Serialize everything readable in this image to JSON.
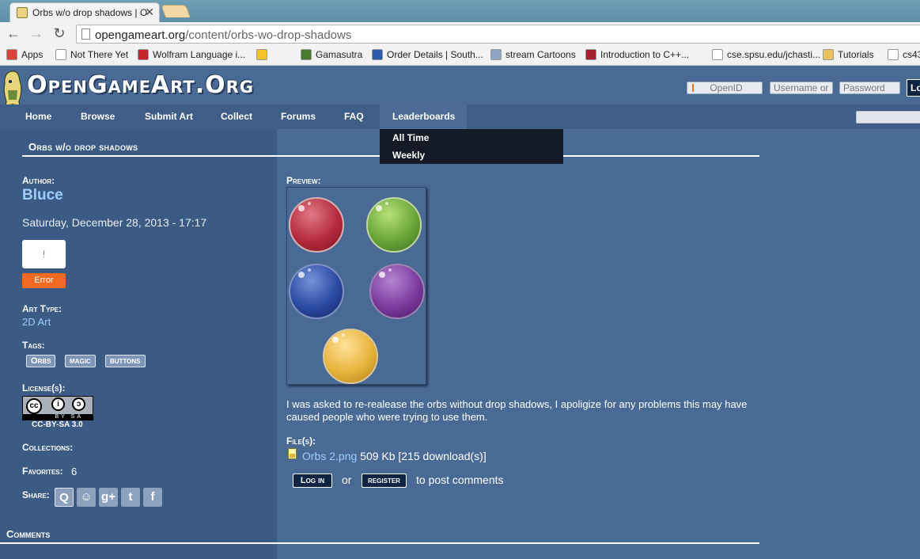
{
  "browser": {
    "tab_title": "Orbs w/o drop shadows | O",
    "tab_close": "✕",
    "url_host": "opengameart.org",
    "url_path": "/content/orbs-wo-drop-shadows",
    "back": "←",
    "forward": "→",
    "reload": "↻",
    "bookmarks": [
      {
        "label": "Apps",
        "color": "#d9453d"
      },
      {
        "label": "Not There Yet",
        "color": "#ffffff"
      },
      {
        "label": "Wolfram Language i...",
        "color": "#c8232c"
      },
      {
        "label": "",
        "color": "#f6c22a"
      },
      {
        "label": "Gamasutra",
        "color": "#4a7a2c"
      },
      {
        "label": "Order Details | South...",
        "color": "#2a5aa8"
      },
      {
        "label": "stream Cartoons",
        "color": "#8fa3c7"
      },
      {
        "label": "Introduction to C++...",
        "color": "#a3212d"
      },
      {
        "label": "cse.spsu.edu/jchasti...",
        "color": "#ffffff"
      },
      {
        "label": "Tutorials",
        "color": "#e9c25c"
      },
      {
        "label": "cs43",
        "color": "#ffffff"
      }
    ]
  },
  "header": {
    "logo": "OpenGameArt.Org",
    "openid_placeholder": "OpenID",
    "username_placeholder": "Username or",
    "password_placeholder": "Password",
    "login_label": "Lo"
  },
  "nav": {
    "items": [
      "Home",
      "Browse",
      "Submit Art",
      "Collect",
      "Forums",
      "FAQ",
      "Leaderboards"
    ],
    "dropdown": [
      "All Time",
      "Weekly"
    ]
  },
  "page": {
    "title": "Orbs w/o drop shadows",
    "author_label": "Author:",
    "author": "Bluce",
    "date": "Saturday, December 28, 2013 - 17:17",
    "error_box": "!",
    "error_button": "Error",
    "art_type_label": "Art Type:",
    "art_type": "2D Art",
    "tags_label": "Tags:",
    "tags": [
      "Orbs",
      "magic",
      "buttons"
    ],
    "license_label": "License(s):",
    "license_badge_text": "BY SA",
    "license": "CC-BY-SA 3.0",
    "collections_label": "Collections:",
    "favorites_label": "Favorites:",
    "favorites": "6",
    "share_label": "Share:",
    "share_icons": [
      "Q",
      "☺",
      "g+",
      "t",
      "f"
    ],
    "comments_label": "Comments",
    "preview_label": "Preview:",
    "description": "I was asked to re-realease the orbs without drop shadows, I apoligize for any problems this may have caused people who were trying to use them.",
    "files_label": "File(s):",
    "file_name": "Orbs 2.png",
    "file_info": "509 Kb [215 download(s)]",
    "login_btn": "Log in",
    "or": "or",
    "register_btn": "register",
    "post_comments": "to post comments"
  }
}
